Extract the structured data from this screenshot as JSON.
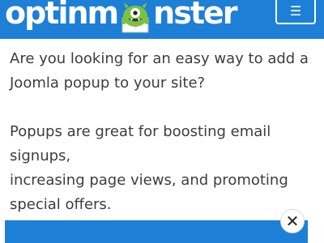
{
  "header": {
    "logo_left": "optinm",
    "logo_right": "nster",
    "menu_icon": "☰"
  },
  "content": {
    "paragraph1_line1": "Are you looking for an easy way to add a",
    "paragraph1_line2": "Joomla popup to your site?",
    "paragraph2_line1": "Popups are great for boosting email signups,",
    "paragraph2_line2": "increasing page views, and promoting",
    "paragraph2_line3": "special offers."
  },
  "popup": {
    "close_icon": "✕"
  },
  "colors": {
    "brand_blue": "#1d7fd6",
    "text": "#3d3d3d",
    "mascot_green": "#7cc242"
  },
  "icons": [
    "hamburger-menu-icon",
    "monster-mascot-icon",
    "close-icon"
  ]
}
